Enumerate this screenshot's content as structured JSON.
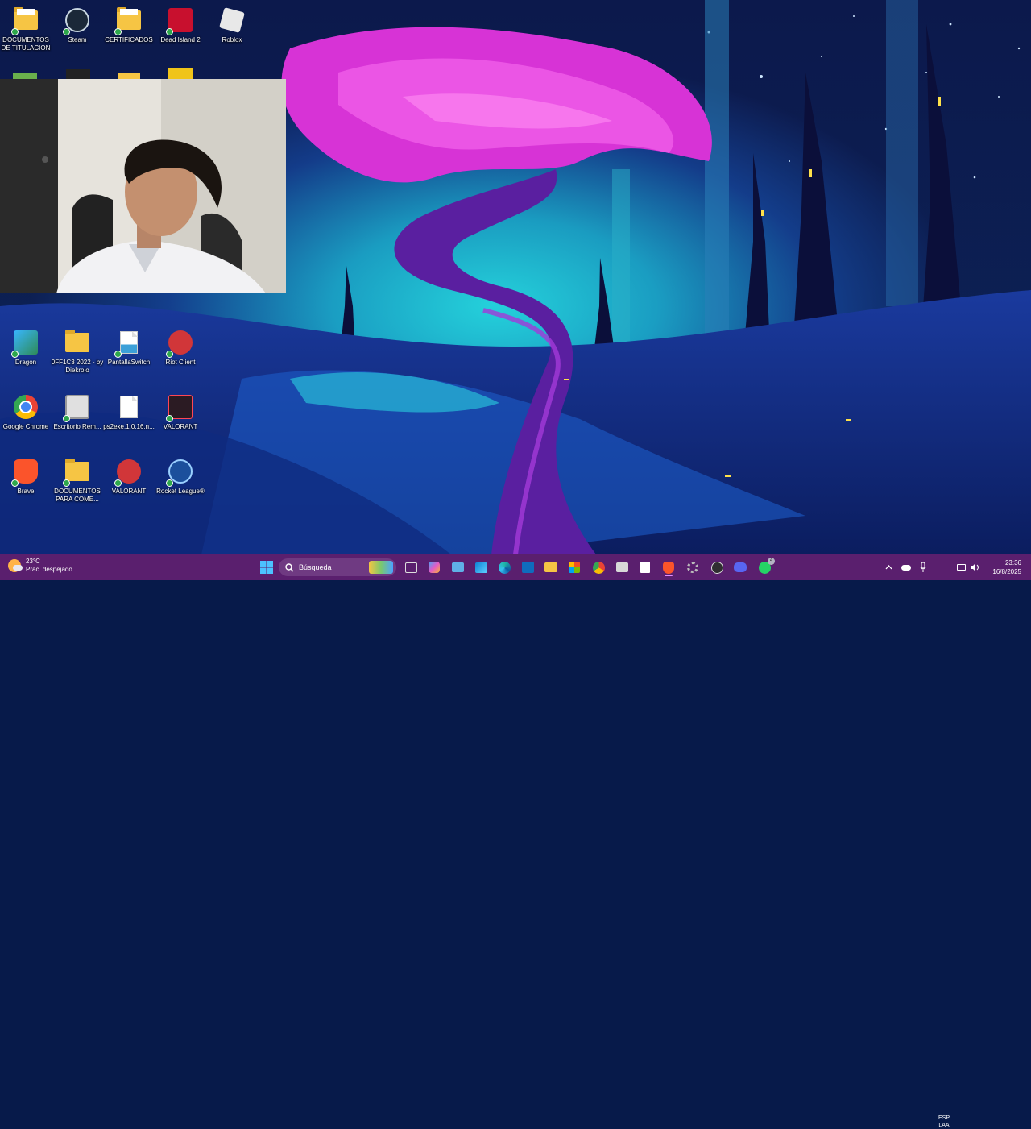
{
  "desktop": {
    "icons": [
      {
        "id": "doc-titulacion",
        "label": "DOCUMENTOS DE TITULACION"
      },
      {
        "id": "steam",
        "label": "Steam"
      },
      {
        "id": "certificados",
        "label": "CERTIFICADOS"
      },
      {
        "id": "dead-island",
        "label": "Dead Island 2"
      },
      {
        "id": "roblox",
        "label": "Roblox"
      },
      {
        "id": "dragon",
        "label": "Dragon"
      },
      {
        "id": "off1c3",
        "label": "0FF1C3 2022 - by Diekrolo"
      },
      {
        "id": "pantalla-switch",
        "label": "PantallaSwitch"
      },
      {
        "id": "riot-client",
        "label": "Riot Client"
      },
      {
        "id": "google-chrome",
        "label": "Google Chrome"
      },
      {
        "id": "escritorio-remoto",
        "label": "Escritorio Rem..."
      },
      {
        "id": "ps2exe",
        "label": "ps2exe.1.0.16.n..."
      },
      {
        "id": "valorant-1",
        "label": "VALORANT"
      },
      {
        "id": "brave",
        "label": "Brave"
      },
      {
        "id": "docs-para-come",
        "label": "DOCUMENTOS PARA COME..."
      },
      {
        "id": "valorant-2",
        "label": "VALORANT"
      },
      {
        "id": "rocket-league",
        "label": "Rocket League®"
      }
    ]
  },
  "taskbar": {
    "weather": {
      "temp": "23°C",
      "desc": "Prac. despejado"
    },
    "search_placeholder": "Búsqueda",
    "tray": {
      "lang_top": "ESP",
      "lang_bottom": "LAA"
    },
    "clock": {
      "time": "23:36",
      "date": "16/8/2025"
    },
    "whatsapp_badge": "4"
  },
  "colors": {
    "taskbar": "#5a1f6e",
    "accent": "#e58cff"
  }
}
